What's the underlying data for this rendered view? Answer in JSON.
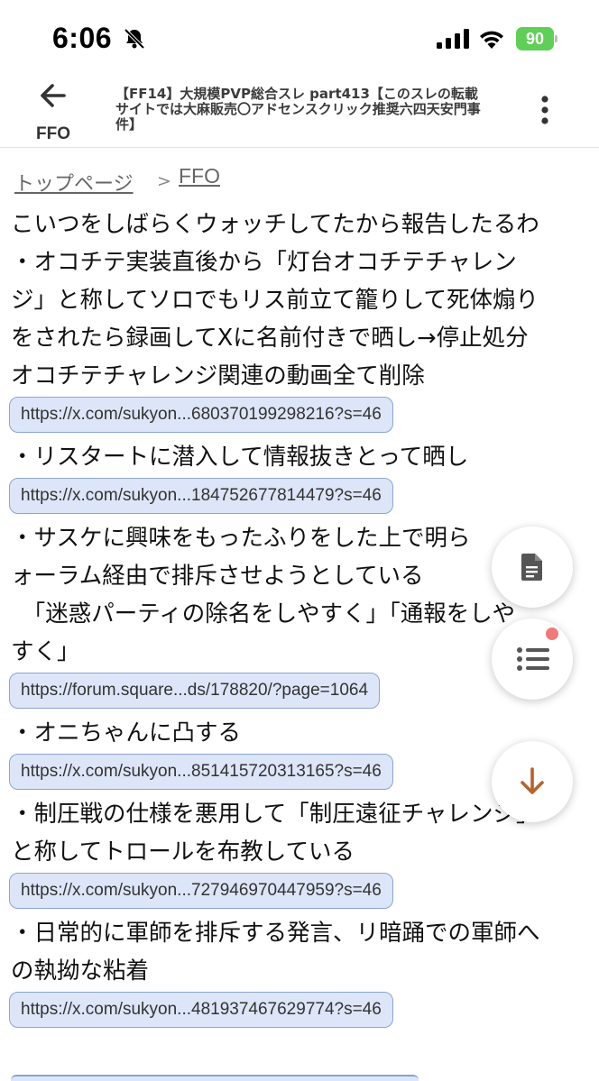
{
  "status_bar": {
    "time": "6:06",
    "battery": "90",
    "icons": [
      "bell-slash-icon",
      "cellular-signal-icon",
      "wifi-icon",
      "battery-icon"
    ]
  },
  "header": {
    "back_icon": "arrow-back-icon",
    "site_label": "FFO",
    "title": "【FF14】大規模PVP総合スレ part413【このスレの転載 サイトでは大麻販売〇アドセンスクリック推奨六四天安門事件】",
    "menu_icon": "more-vertical-icon"
  },
  "breadcrumb": {
    "top": "トップページ",
    "separator": ">",
    "current": "FFO"
  },
  "post": {
    "lines": [
      "こいつをしばらくウォッチしてたから報告したるわ",
      "・オコチテ実装直後から「灯台オコチテチャレン",
      "ジ」と称してソロでもリス前立て籠りして死体煽り",
      "をされたら録画してXに名前付きで晒し→停止処分",
      "オコチテチャレンジ関連の動画全て削除"
    ],
    "link1": "https://x.com/sukyon...680370199298216?s=46",
    "line_restart": "・リスタートに潜入して情報抜きとって晒し",
    "link2": "https://x.com/sukyon...184752677814479?s=46",
    "lines_sasuke": [
      "・サスケに興味をもったふりをした上で明ら",
      "ォーラム経由で排斥させようとしている",
      "　「迷惑パーティの除名をしやすく」「通報をしや",
      "すく」"
    ],
    "link3": "https://forum.square...ds/178820/?page=1064",
    "line_oni": "・オニちゃんに凸する",
    "link4": "https://x.com/sukyon...851415720313165?s=46",
    "lines_seiatsu": [
      "・制圧戦の仕様を悪用して「制圧遠征チャレンジ」",
      "と称してトロールを布教している"
    ],
    "link5": "https://x.com/sukyon...727946970447959?s=46",
    "lines_gunshi": [
      "・日常的に軍師を排斥する発言、リ暗踊での軍師へ",
      "の執拗な粘着"
    ],
    "link6": "https://x.com/sukyon...481937467629774?s=46"
  },
  "fabs": {
    "doc_icon": "document-icon",
    "list_icon": "list-icon",
    "down_icon": "arrow-down-icon",
    "accent_color": "#b5632e",
    "notification_color": "#f07a7a"
  }
}
